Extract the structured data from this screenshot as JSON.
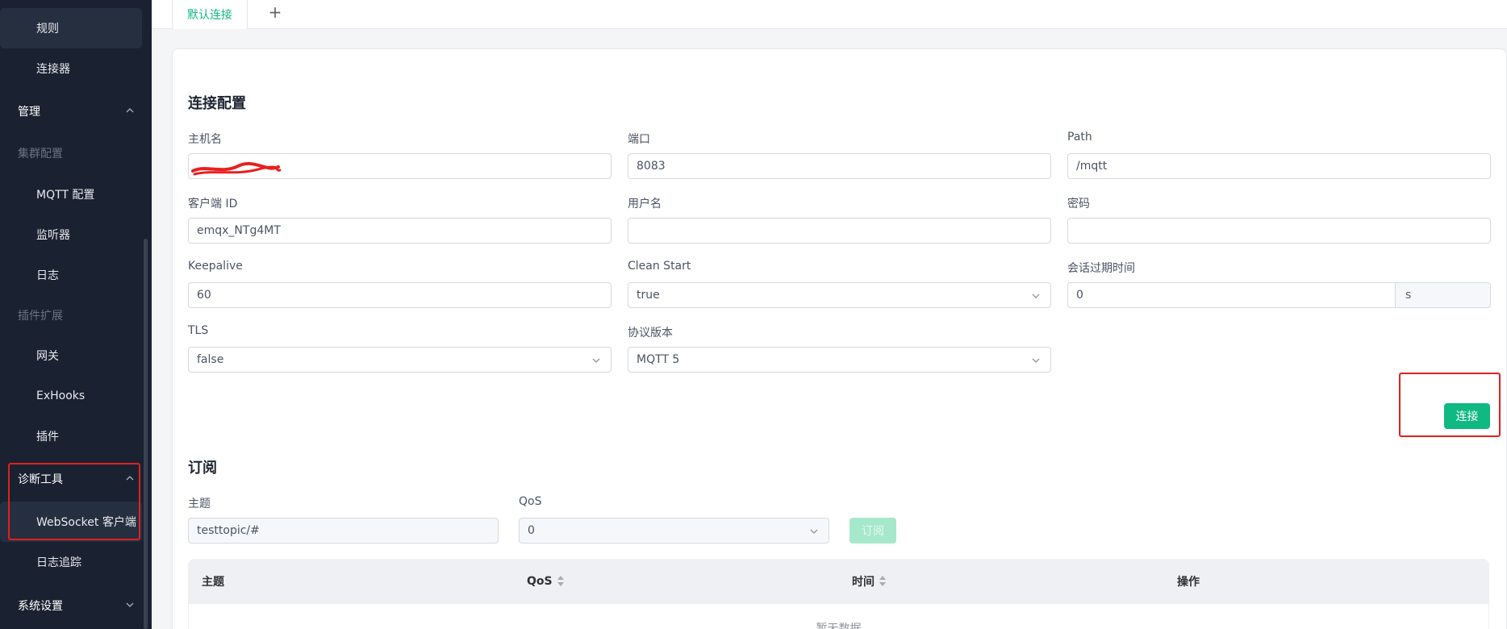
{
  "sidebar": {
    "items": [
      {
        "label": "规则",
        "kind": "child",
        "active": true
      },
      {
        "label": "连接器",
        "kind": "child"
      },
      {
        "label": "管理",
        "kind": "group",
        "expanded": true
      },
      {
        "label": "集群配置",
        "kind": "category"
      },
      {
        "label": "MQTT 配置",
        "kind": "child"
      },
      {
        "label": "监听器",
        "kind": "child"
      },
      {
        "label": "日志",
        "kind": "child"
      },
      {
        "label": "插件扩展",
        "kind": "category"
      },
      {
        "label": "网关",
        "kind": "child"
      },
      {
        "label": "ExHooks",
        "kind": "child"
      },
      {
        "label": "插件",
        "kind": "child"
      },
      {
        "label": "诊断工具",
        "kind": "group",
        "expanded": true
      },
      {
        "label": "WebSocket 客户端",
        "kind": "child",
        "active": true
      },
      {
        "label": "日志追踪",
        "kind": "child"
      },
      {
        "label": "系统设置",
        "kind": "group",
        "expanded": false
      }
    ]
  },
  "tabs": {
    "active_label": "默认连接",
    "add_label": "+"
  },
  "connection": {
    "title": "连接配置",
    "host": {
      "label": "主机名",
      "value": ""
    },
    "port": {
      "label": "端口",
      "value": "8083"
    },
    "path": {
      "label": "Path",
      "value": "/mqtt"
    },
    "client_id": {
      "label": "客户端 ID",
      "value": "emqx_NTg4MT"
    },
    "username": {
      "label": "用户名",
      "value": ""
    },
    "password": {
      "label": "密码",
      "value": ""
    },
    "keepalive": {
      "label": "Keepalive",
      "value": "60"
    },
    "clean_start": {
      "label": "Clean Start",
      "value": "true"
    },
    "session_expiry": {
      "label": "会话过期时间",
      "value": "0",
      "unit": "s"
    },
    "tls": {
      "label": "TLS",
      "value": "false"
    },
    "protocol": {
      "label": "协议版本",
      "value": "MQTT 5"
    },
    "connect_button": "连接"
  },
  "subscription": {
    "title": "订阅",
    "topic": {
      "label": "主题",
      "value": "testtopic/#"
    },
    "qos": {
      "label": "QoS",
      "value": "0"
    },
    "subscribe_button": "订阅"
  },
  "table": {
    "columns": [
      "主题",
      "QoS",
      "时间",
      "操作"
    ],
    "empty_text": "暂无数据"
  },
  "colors": {
    "accent": "#10b981",
    "sidebar_bg": "#1a2231",
    "highlight_box": "#e02020"
  }
}
